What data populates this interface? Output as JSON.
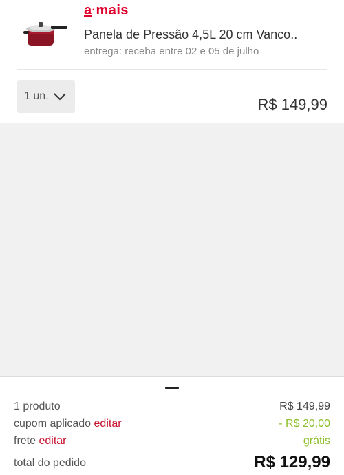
{
  "product": {
    "brand_prefix": "a",
    "brand_suffix": "mais",
    "name": "Panela de Pressão 4,5L 20 cm Vanco..",
    "delivery": "entrega: receba entre 02 e 05 de julho",
    "image_icon": "pressure-cooker-icon"
  },
  "quantity": {
    "selected": "1 un."
  },
  "item_price": "R$ 149,99",
  "summary": {
    "products_label": "1 produto",
    "products_value": "R$ 149,99",
    "coupon_label": "cupom aplicado",
    "coupon_edit": "editar",
    "coupon_value": "- R$ 20,00",
    "shipping_label": "frete",
    "shipping_edit": "editar",
    "shipping_value": "grátis",
    "total_label": "total do pedido",
    "total_value": "R$ 129,99"
  },
  "colors": {
    "brand": "#e0002b",
    "link": "#c8102e",
    "discount": "#8dbf2a"
  }
}
